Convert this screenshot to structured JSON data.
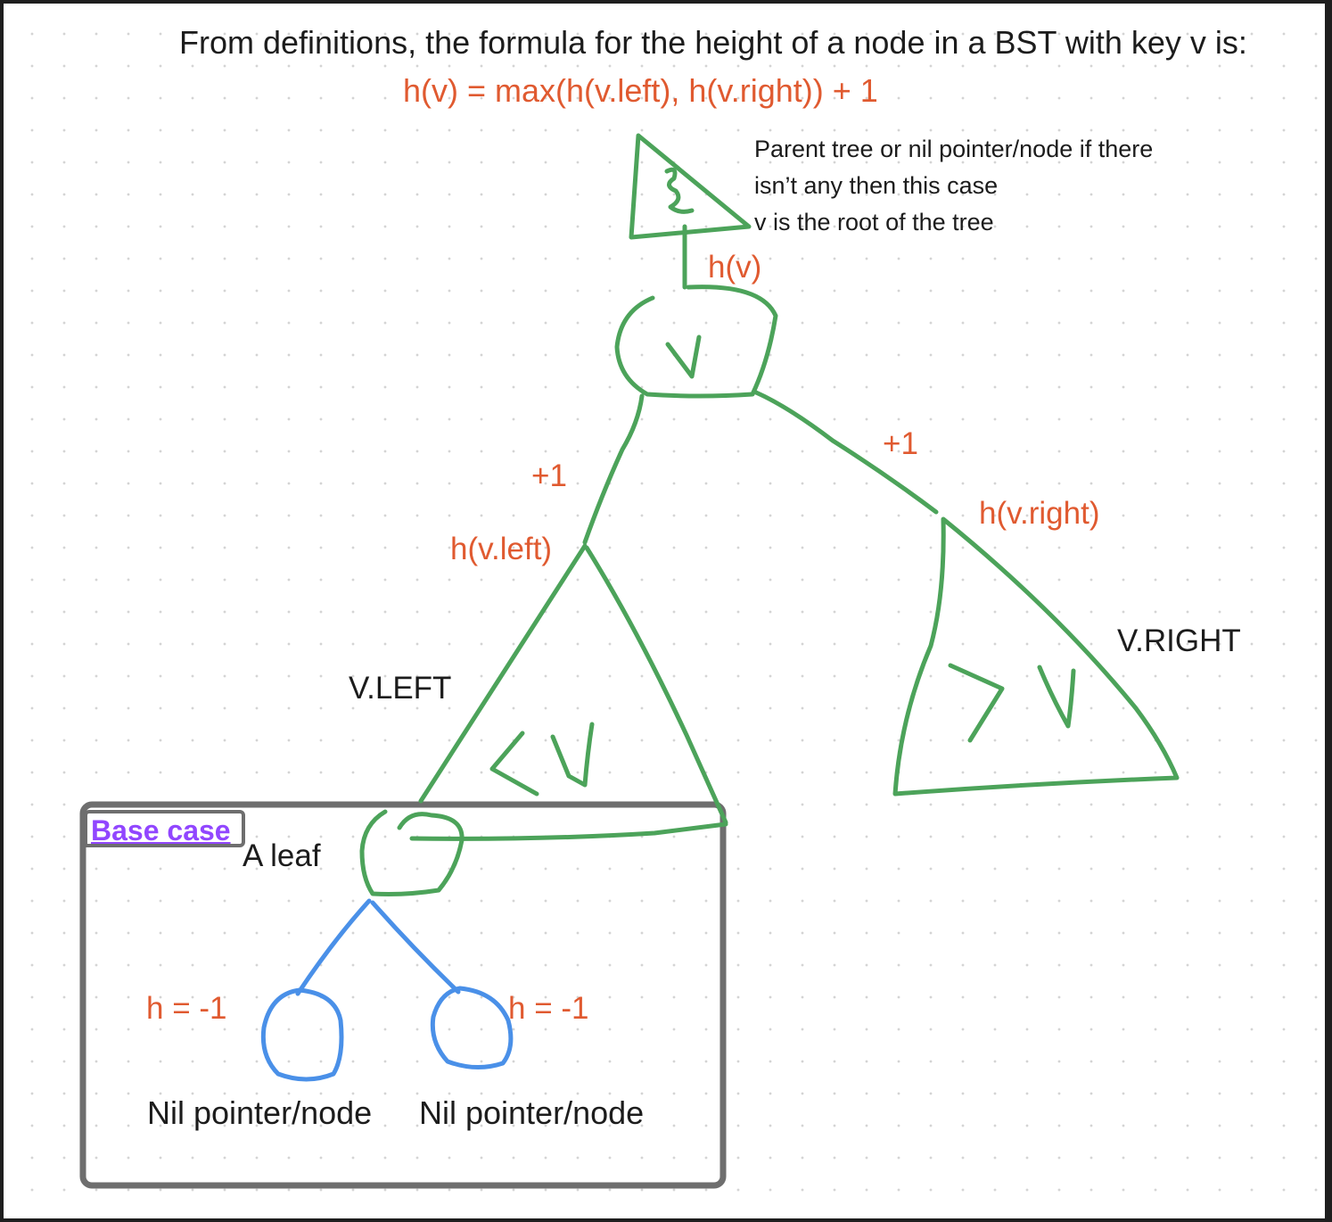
{
  "header": {
    "heading": "From definitions, the formula for the height of a node in a BST with key v is:",
    "formula": "h(v) = max(h(v.left), h(v.right)) + 1"
  },
  "note": {
    "line1": "Parent tree or nil pointer/node if there",
    "line2": "isn’t any then this case",
    "line3": "v is the root of the tree"
  },
  "labels": {
    "h_v": "h(v)",
    "plus_one_left": "+1",
    "plus_one_right": "+1",
    "h_v_left": "h(v.left)",
    "h_v_right": "h(v.right)",
    "v_left": "V.LEFT",
    "v_right": "V.RIGHT",
    "leaf": "A leaf"
  },
  "base_case": {
    "tag": "Base case",
    "h_left": "h = -1",
    "h_right": "h = -1",
    "nil_left": "Nil pointer/node",
    "nil_right": "Nil pointer/node"
  },
  "colors": {
    "text": "#1c1c1c",
    "accent": "#e05a30",
    "tree_stroke": "#4ca35a",
    "nil_stroke": "#4a90e8",
    "frame_stroke": "#6e6e6e",
    "tag_text": "#9146ff"
  }
}
